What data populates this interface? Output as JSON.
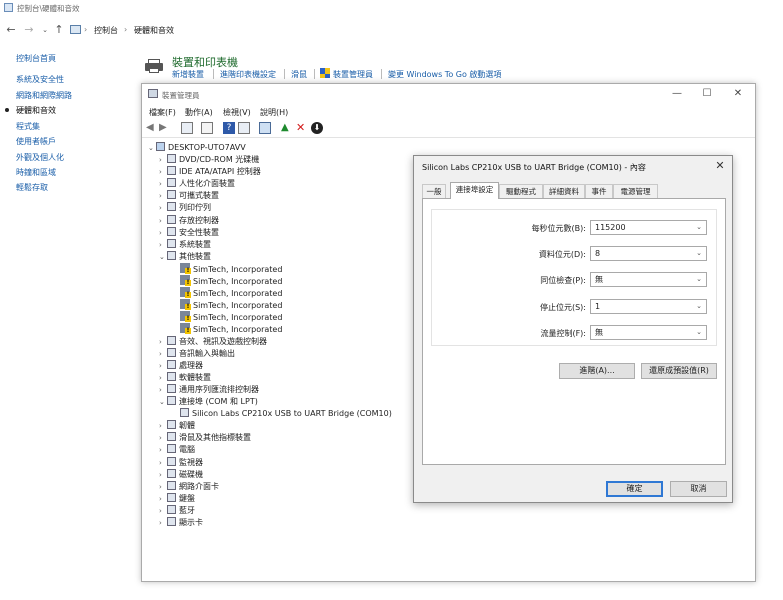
{
  "control_panel": {
    "window_title": "控制台\\硬體和音效",
    "breadcrumb": [
      "控制台",
      "硬體和音效"
    ],
    "sidebar": [
      {
        "label": "控制台首頁",
        "active": false
      },
      {
        "label": "系統及安全性",
        "active": false
      },
      {
        "label": "網路和網際網路",
        "active": false
      },
      {
        "label": "硬體和音效",
        "active": true
      },
      {
        "label": "程式集",
        "active": false
      },
      {
        "label": "使用者帳戶",
        "active": false
      },
      {
        "label": "外觀及個人化",
        "active": false
      },
      {
        "label": "時鐘和區域",
        "active": false
      },
      {
        "label": "輕鬆存取",
        "active": false
      }
    ],
    "section_title": "裝置和印表機",
    "section_links": [
      "新增裝置",
      "進階印表機設定",
      "滑鼠",
      "裝置管理員",
      "變更 Windows To Go 啟動選項"
    ]
  },
  "device_manager": {
    "title": "裝置管理員",
    "menu": [
      "檔案(F)",
      "動作(A)",
      "檢視(V)",
      "說明(H)"
    ],
    "root": "DESKTOP-UTO7AVV",
    "tree": [
      {
        "label": "DVD/CD-ROM 光碟機",
        "level": 1,
        "expanded": false,
        "icon": "disc-drive"
      },
      {
        "label": "IDE ATA/ATAPI 控制器",
        "level": 1,
        "expanded": false,
        "icon": "controller"
      },
      {
        "label": "人性化介面裝置",
        "level": 1,
        "expanded": false,
        "icon": "hid"
      },
      {
        "label": "可攜式裝置",
        "level": 1,
        "expanded": false,
        "icon": "portable"
      },
      {
        "label": "列印佇列",
        "level": 1,
        "expanded": false,
        "icon": "printer"
      },
      {
        "label": "存放控制器",
        "level": 1,
        "expanded": false,
        "icon": "storage"
      },
      {
        "label": "安全性裝置",
        "level": 1,
        "expanded": false,
        "icon": "security"
      },
      {
        "label": "系統裝置",
        "level": 1,
        "expanded": false,
        "icon": "system"
      },
      {
        "label": "其他裝置",
        "level": 1,
        "expanded": true,
        "icon": "other"
      },
      {
        "label": "SimTech, Incorporated",
        "level": 2,
        "icon": "warning"
      },
      {
        "label": "SimTech, Incorporated",
        "level": 2,
        "icon": "warning"
      },
      {
        "label": "SimTech, Incorporated",
        "level": 2,
        "icon": "warning"
      },
      {
        "label": "SimTech, Incorporated",
        "level": 2,
        "icon": "warning"
      },
      {
        "label": "SimTech, Incorporated",
        "level": 2,
        "icon": "warning"
      },
      {
        "label": "SimTech, Incorporated",
        "level": 2,
        "icon": "warning"
      },
      {
        "label": "音效、視訊及遊戲控制器",
        "level": 1,
        "expanded": false,
        "icon": "sound"
      },
      {
        "label": "音訊輸入與輸出",
        "level": 1,
        "expanded": false,
        "icon": "audio"
      },
      {
        "label": "處理器",
        "level": 1,
        "expanded": false,
        "icon": "cpu"
      },
      {
        "label": "軟體裝置",
        "level": 1,
        "expanded": false,
        "icon": "software"
      },
      {
        "label": "通用序列匯流排控制器",
        "level": 1,
        "expanded": false,
        "icon": "usb"
      },
      {
        "label": "連接埠 (COM 和 LPT)",
        "level": 1,
        "expanded": true,
        "icon": "port"
      },
      {
        "label": "Silicon Labs CP210x USB to UART Bridge (COM10)",
        "level": 2,
        "icon": "port"
      },
      {
        "label": "韌體",
        "level": 1,
        "expanded": false,
        "icon": "firmware"
      },
      {
        "label": "滑鼠及其他指標裝置",
        "level": 1,
        "expanded": false,
        "icon": "mouse"
      },
      {
        "label": "電腦",
        "level": 1,
        "expanded": false,
        "icon": "computer"
      },
      {
        "label": "監視器",
        "level": 1,
        "expanded": false,
        "icon": "monitor"
      },
      {
        "label": "磁碟機",
        "level": 1,
        "expanded": false,
        "icon": "disk"
      },
      {
        "label": "網路介面卡",
        "level": 1,
        "expanded": false,
        "icon": "network"
      },
      {
        "label": "鍵盤",
        "level": 1,
        "expanded": false,
        "icon": "keyboard"
      },
      {
        "label": "藍牙",
        "level": 1,
        "expanded": false,
        "icon": "bluetooth"
      },
      {
        "label": "顯示卡",
        "level": 1,
        "expanded": false,
        "icon": "display"
      }
    ]
  },
  "dialog": {
    "title": "Silicon Labs CP210x USB to UART Bridge (COM10) - 內容",
    "tabs": [
      "一般",
      "連接埠設定",
      "驅動程式",
      "詳細資料",
      "事件",
      "電源管理"
    ],
    "selected_tab": 1,
    "fields": [
      {
        "label": "每秒位元數(B):",
        "value": "115200"
      },
      {
        "label": "資料位元(D):",
        "value": "8"
      },
      {
        "label": "同位檢查(P):",
        "value": "無"
      },
      {
        "label": "停止位元(S):",
        "value": "1"
      },
      {
        "label": "流量控制(F):",
        "value": "無"
      }
    ],
    "advanced_button": "進階(A)...",
    "restore_button": "還原成預設值(R)",
    "ok_button": "確定",
    "cancel_button": "取消"
  },
  "colors": {
    "link": "#1a5ea8",
    "accent": "#2f78d4",
    "title_green": "#1e6a2c"
  }
}
